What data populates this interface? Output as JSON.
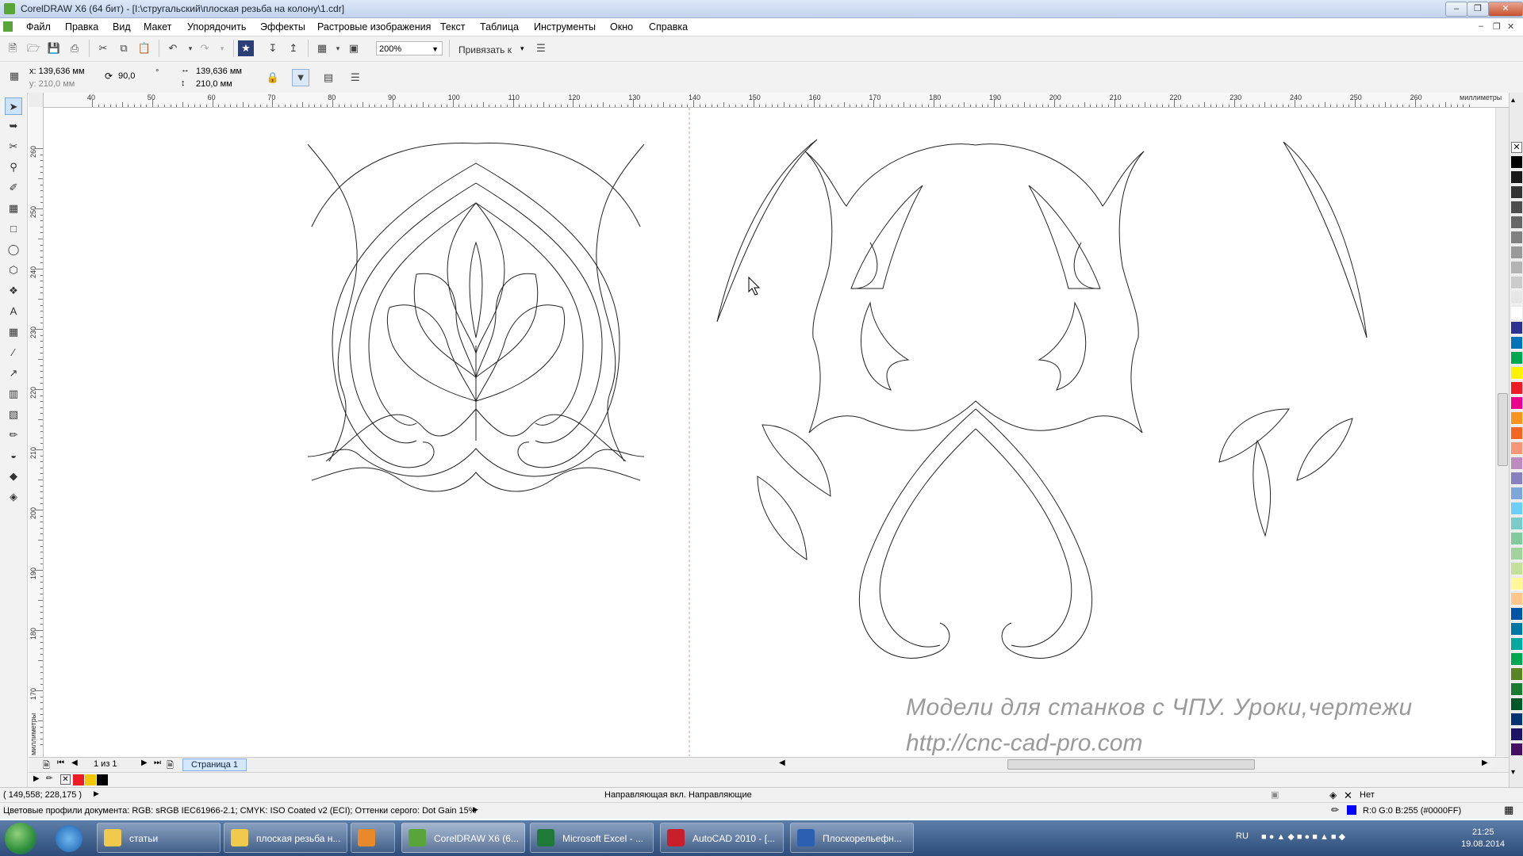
{
  "window": {
    "title": "CorelDRAW X6 (64 бит) - [I:\\стругальский\\плоская резьба на колону\\1.cdr]"
  },
  "menu": {
    "items": [
      "Файл",
      "Правка",
      "Вид",
      "Макет",
      "Упорядочить",
      "Эффекты",
      "Растровые изображения",
      "Текст",
      "Таблица",
      "Инструменты",
      "Окно",
      "Справка"
    ]
  },
  "standard_toolbar": {
    "zoom": "200%",
    "snap_label": "Привязать к"
  },
  "property_bar": {
    "x_value": "x: 139,636 мм",
    "y_value": "y: 210,0 мм",
    "angle": "90,0",
    "width": "139,636 мм",
    "height": "210,0 мм"
  },
  "rulers": {
    "unit": "миллиметры",
    "h_ticks": [
      "40",
      "50",
      "60",
      "70",
      "80",
      "90",
      "100",
      "110",
      "120",
      "130",
      "140",
      "150",
      "160",
      "170",
      "180",
      "190",
      "200",
      "210",
      "220",
      "230",
      "240",
      "250",
      "260"
    ],
    "v_ticks": [
      "260",
      "250",
      "240",
      "230",
      "220",
      "210",
      "200",
      "190",
      "180",
      "170"
    ],
    "v_unit": "миллиметры"
  },
  "navigator": {
    "page_of": "1 из 1",
    "page_tab": "Страница 1"
  },
  "status": {
    "coords": "( 149,558; 228,175 )",
    "guides": "Направляющая вкл. Направляющие",
    "color_profiles": "Цветовые профили документа: RGB: sRGB IEC61966-2.1; CMYK: ISO Coated v2 (ECI); Оттенки серого: Dot Gain 15%",
    "fill_label": "Нет",
    "outline_color": "R:0 G:0 B:255 (#0000FF)"
  },
  "watermark": {
    "line1": "Модели для станков с ЧПУ. Уроки,чертежи",
    "line2": "http://cnc-cad-pro.com"
  },
  "taskbar": {
    "tasks": [
      "статьи",
      "плоская резьба н...",
      "",
      "CorelDRAW X6 (6...",
      "Microsoft Excel - ...",
      "AutoCAD 2010 - [...",
      "Плоскорельефн..."
    ],
    "lang": "RU",
    "time": "21:25",
    "date": "19.08.2014"
  },
  "colors": {
    "accent": "#0000FF",
    "palette": [
      "#000000",
      "#1a1a1a",
      "#333333",
      "#4d4d4d",
      "#666666",
      "#808080",
      "#999999",
      "#b3b3b3",
      "#cccccc",
      "#e6e6e6",
      "#ffffff",
      "#2e3192",
      "#0072bc",
      "#00a651",
      "#fff200",
      "#ed1c24",
      "#ec008c",
      "#f7941d",
      "#f26522",
      "#f69679",
      "#bd8cbf",
      "#8781bd",
      "#7da7d9",
      "#6dcff6",
      "#7accc8",
      "#82ca9c",
      "#a2d39c",
      "#c4df9b",
      "#fff799",
      "#fdc68a",
      "#0054a6",
      "#0076a3",
      "#00a99d",
      "#00a651",
      "#598527",
      "#197b30",
      "#005826",
      "#003471",
      "#1b1464",
      "#440e62"
    ],
    "doc_palette": [
      "#ed1c24",
      "#f7c600",
      "#000000"
    ]
  }
}
